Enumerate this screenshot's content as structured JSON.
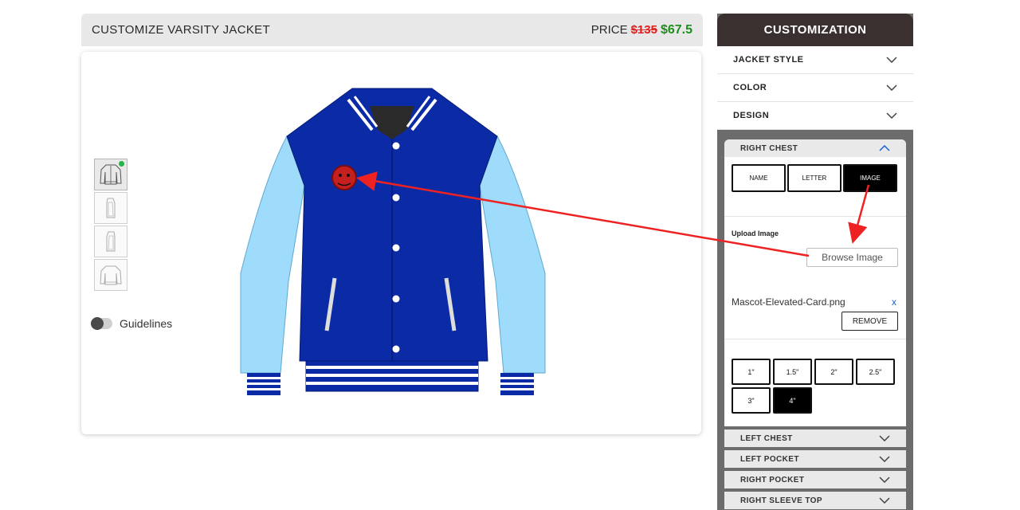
{
  "header": {
    "title": "CUSTOMIZE VARSITY JACKET",
    "price_label": "PRICE",
    "price_old": "$135",
    "price_new": "$67.5"
  },
  "canvas": {
    "guidelines_label": "Guidelines",
    "guidelines_on": false,
    "selected_view": 0
  },
  "sidebar": {
    "title": "CUSTOMIZATION",
    "sections": [
      {
        "label": "JACKET STYLE"
      },
      {
        "label": "COLOR"
      },
      {
        "label": "DESIGN"
      }
    ],
    "design_panel": {
      "title": "RIGHT CHEST",
      "tabs": [
        "NAME",
        "LETTER",
        "IMAGE"
      ],
      "selected_tab": "IMAGE",
      "upload_label": "Upload Image",
      "browse_label": "Browse Image",
      "file_name": "Mascot-Elevated-Card.png",
      "file_remove_x": "x",
      "remove_label": "REMOVE",
      "sizes": [
        "1\"",
        "1.5\"",
        "2\"",
        "2.5\"",
        "3\"",
        "4\""
      ],
      "selected_size": "4\""
    },
    "subsections": [
      {
        "label": "LEFT CHEST"
      },
      {
        "label": "LEFT POCKET"
      },
      {
        "label": "RIGHT POCKET"
      },
      {
        "label": "RIGHT SLEEVE TOP"
      }
    ]
  },
  "colors": {
    "body": "#0a2aa6",
    "sleeves": "#9fdcfb",
    "stripe_white": "#ffffff",
    "annotation_arrow": "#ee2222",
    "price_old": "#e11d1d",
    "price_new": "#1e8e1e",
    "sidebar_header": "#3a3030"
  }
}
